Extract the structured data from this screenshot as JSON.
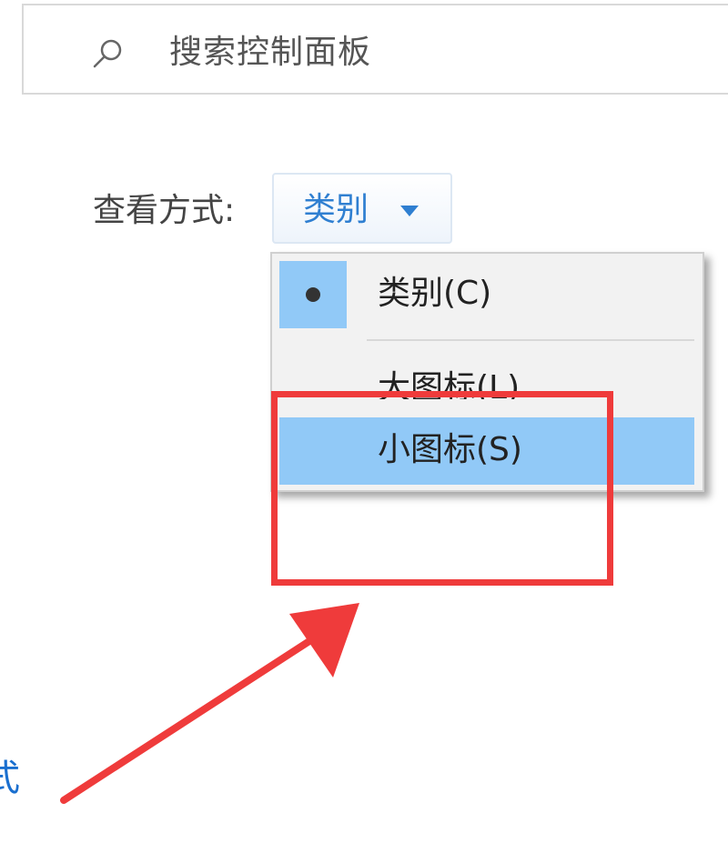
{
  "search": {
    "placeholder": "搜索控制面板",
    "icon": "search-icon"
  },
  "view": {
    "label": "查看方式:",
    "selected": "类别",
    "caret_icon": "caret-down-icon"
  },
  "menu": {
    "items": [
      {
        "label": "类别(C)",
        "selected": true
      },
      {
        "label": "大图标(L)",
        "selected": false
      },
      {
        "label": "小图标(S)",
        "selected": false,
        "highlighted": true
      }
    ]
  },
  "annotation": {
    "color": "#ef3b3b",
    "target": "小图标(S)"
  },
  "side": {
    "text": "式"
  }
}
